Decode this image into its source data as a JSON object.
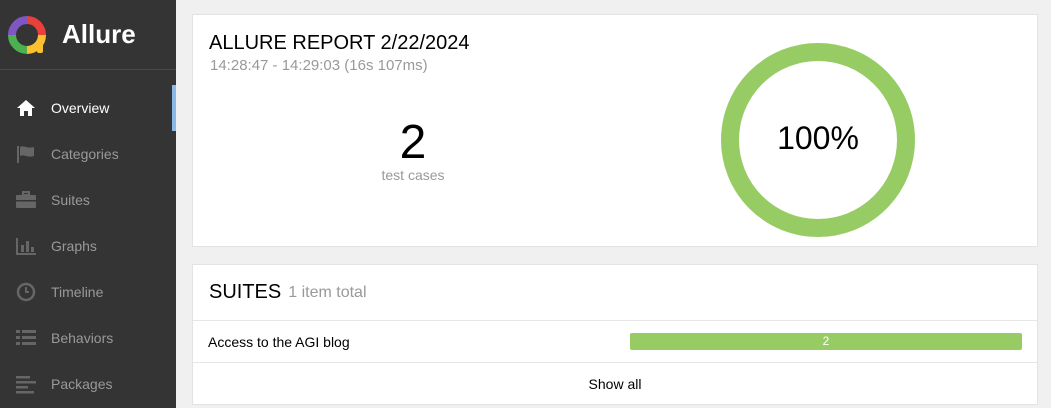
{
  "brand": {
    "name": "Allure"
  },
  "nav": [
    {
      "label": "Overview",
      "icon": "home-icon",
      "active": true
    },
    {
      "label": "Categories",
      "icon": "flag-icon",
      "active": false
    },
    {
      "label": "Suites",
      "icon": "briefcase-icon",
      "active": false
    },
    {
      "label": "Graphs",
      "icon": "bar-chart-icon",
      "active": false
    },
    {
      "label": "Timeline",
      "icon": "clock-icon",
      "active": false
    },
    {
      "label": "Behaviors",
      "icon": "list-icon",
      "active": false
    },
    {
      "label": "Packages",
      "icon": "align-left-icon",
      "active": false
    }
  ],
  "summary": {
    "title": "ALLURE REPORT 2/22/2024",
    "time": "14:28:47 - 14:29:03 (16s 107ms)",
    "test_count": "2",
    "test_count_label": "test cases",
    "success_rate": "100%",
    "success_fraction": 1.0,
    "ring_color": "#97cc64"
  },
  "suites": {
    "title": "SUITES",
    "subtitle": "1 item total",
    "items": [
      {
        "name": "Access to the AGI blog",
        "passed": "2",
        "passed_fraction": 1.0
      }
    ],
    "show_all": "Show all"
  },
  "colors": {
    "sidebar_bg": "#343434",
    "active_indicator": "#8ab9e8",
    "passed": "#97cc64"
  }
}
